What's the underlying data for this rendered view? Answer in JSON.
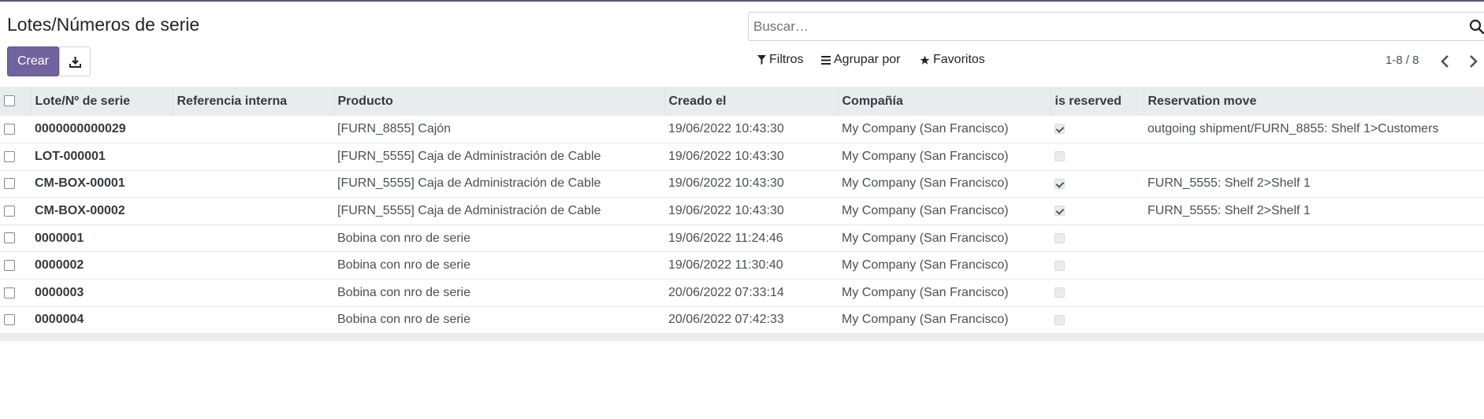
{
  "page": {
    "title": "Lotes/Números de serie"
  },
  "search": {
    "placeholder": "Buscar…"
  },
  "buttons": {
    "create": "Crear"
  },
  "filters": {
    "filters_label": "Filtros",
    "groupby_label": "Agrupar por",
    "favorites_label": "Favoritos"
  },
  "pager": {
    "value": "1-8 / 8"
  },
  "table": {
    "headers": [
      "Lote/Nº de serie",
      "Referencia interna",
      "Producto",
      "Creado el",
      "Compañía",
      "is reserved",
      "Reservation move"
    ],
    "rows": [
      {
        "lot": "0000000000029",
        "ref": "",
        "product": "[FURN_8855] Cajón",
        "created": "19/06/2022 10:43:30",
        "company": "My Company (San Francisco)",
        "reserved": true,
        "move": "outgoing shipment/FURN_8855: Shelf 1>Customers"
      },
      {
        "lot": "LOT-000001",
        "ref": "",
        "product": "[FURN_5555] Caja de Administración de Cable",
        "created": "19/06/2022 10:43:30",
        "company": "My Company (San Francisco)",
        "reserved": false,
        "move": ""
      },
      {
        "lot": "CM-BOX-00001",
        "ref": "",
        "product": "[FURN_5555] Caja de Administración de Cable",
        "created": "19/06/2022 10:43:30",
        "company": "My Company (San Francisco)",
        "reserved": true,
        "move": "FURN_5555: Shelf 2>Shelf 1"
      },
      {
        "lot": "CM-BOX-00002",
        "ref": "",
        "product": "[FURN_5555] Caja de Administración de Cable",
        "created": "19/06/2022 10:43:30",
        "company": "My Company (San Francisco)",
        "reserved": true,
        "move": "FURN_5555: Shelf 2>Shelf 1"
      },
      {
        "lot": "0000001",
        "ref": "",
        "product": "Bobina con nro de serie",
        "created": "19/06/2022 11:24:46",
        "company": "My Company (San Francisco)",
        "reserved": false,
        "move": ""
      },
      {
        "lot": "0000002",
        "ref": "",
        "product": "Bobina con nro de serie",
        "created": "19/06/2022 11:30:40",
        "company": "My Company (San Francisco)",
        "reserved": false,
        "move": ""
      },
      {
        "lot": "0000003",
        "ref": "",
        "product": "Bobina con nro de serie",
        "created": "20/06/2022 07:33:14",
        "company": "My Company (San Francisco)",
        "reserved": false,
        "move": ""
      },
      {
        "lot": "0000004",
        "ref": "",
        "product": "Bobina con nro de serie",
        "created": "20/06/2022 07:42:33",
        "company": "My Company (San Francisco)",
        "reserved": false,
        "move": ""
      }
    ]
  },
  "colors": {
    "brand": "#71639e",
    "topline": "#5e4f7a",
    "header_bg": "#e9ecef"
  },
  "icons": {
    "search": "search-icon",
    "download": "download-icon",
    "filter": "filter-icon",
    "groupby": "list-icon",
    "favorites": "star-icon",
    "prev": "chevron-left-icon",
    "next": "chevron-right-icon"
  }
}
